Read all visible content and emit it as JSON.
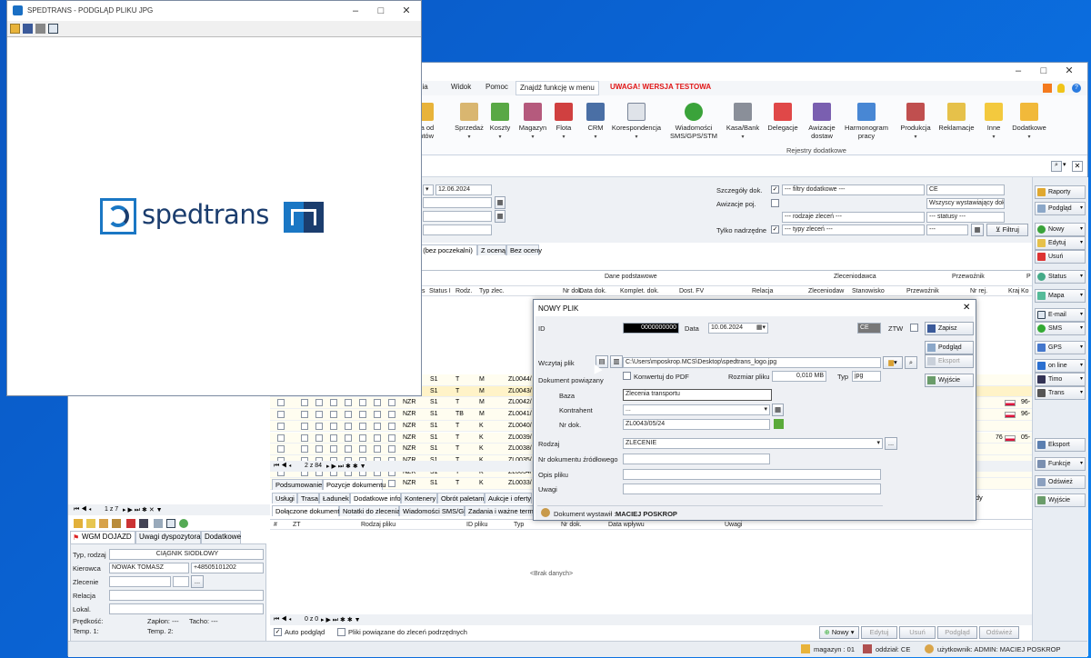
{
  "jpg_window": {
    "title": "SPEDTRANS - PODGLĄD PLIKU JPG",
    "logo_text": "spedtrans",
    "logo_colors": {
      "blue": "#1a77c4",
      "dark": "#1b3d6e"
    }
  },
  "main": {
    "menu": [
      "dzia",
      "Widok",
      "Pomoc",
      "Znajdź funkcję w menu"
    ],
    "warning": "UWAGA! WERSJA TESTOWA",
    "ribbon": [
      {
        "label": "nia od\nentów",
        "icon": "user-icon"
      },
      {
        "label": "Sprzedaż",
        "icon": "sales-icon"
      },
      {
        "label": "Koszty",
        "icon": "costs-icon"
      },
      {
        "label": "Magazyn",
        "icon": "warehouse-icon"
      },
      {
        "label": "Flota",
        "icon": "fleet-icon"
      },
      {
        "label": "CRM",
        "icon": "crm-icon"
      },
      {
        "label": "Korespondencja",
        "icon": "mail-icon"
      },
      {
        "label": "Wiadomości\nSMS/GPS/STM",
        "icon": "sms-icon"
      },
      {
        "label": "Kasa/Bank",
        "icon": "cash-icon"
      },
      {
        "label": "Delegacje",
        "icon": "calendar-icon"
      },
      {
        "label": "Awizacje\ndostaw",
        "icon": "notice-icon"
      },
      {
        "label": "Harmonogram\npracy",
        "icon": "schedule-icon"
      },
      {
        "label": "Produkcja",
        "icon": "production-icon"
      },
      {
        "label": "Reklamacje",
        "icon": "complaint-icon"
      },
      {
        "label": "Inne",
        "icon": "folder-icon"
      },
      {
        "label": "Dodatkowe",
        "icon": "folder-open-icon"
      }
    ],
    "ribbon_group": "Rejestry dodatkowe",
    "filters": {
      "date_to": "12.06.2024",
      "details_label": "Szczegóły dok.",
      "details_value": "--- filtry dodatkowe ---",
      "awizacje_label": "Awizacje poj.",
      "kinds_value": "--- rodzaje zleceń ---",
      "parent_label": "Tylko nadrzędne",
      "types_value": "--- typy zleceń ---",
      "ce_value": "CE",
      "issuers_value": "Wszyscy wystawiający dok.",
      "statuses_value": "--- statusy ---",
      "dash_value": "---",
      "filter_btn": "Filtruj"
    },
    "grade_tabs": [
      "e (bez poczekalni)",
      "Z oceną",
      "Bez oceny"
    ],
    "grid": {
      "group_main": "Dane podstawowe",
      "group_client": "Zleceniodawca",
      "group_carrier": "Przewoźnik",
      "group_p": "P",
      "headers": [
        "s",
        "Status I",
        "Rodz.",
        "Typ zlec.",
        "Nr dok.",
        "Data dok.",
        "Komplet. dok.",
        "Dost. FV",
        "Relacja",
        "Zleceniodaw",
        "Stanowisko",
        "Przewoźnik",
        "Nr rej.",
        "Kraj",
        "Ko"
      ],
      "rows": [
        {
          "status": "S1",
          "rodz": "T",
          "typ": "M",
          "nr": "ZL0044/",
          "k": "",
          "ko": ""
        },
        {
          "status": "S1",
          "rodz": "T",
          "typ": "M",
          "nr": "ZL0043/",
          "k": "",
          "ko": ""
        },
        {
          "status": "S1",
          "rodz": "T",
          "typ": "M",
          "nr": "ZL0042/",
          "k": "",
          "ko": "96-"
        },
        {
          "status": "S1",
          "rodz": "TB",
          "typ": "M",
          "nr": "ZL0041/",
          "k": "",
          "ko": "96-"
        },
        {
          "status": "S1",
          "rodz": "T",
          "typ": "K",
          "nr": "ZL0040/",
          "k": "",
          "ko": ""
        },
        {
          "status": "S1",
          "rodz": "T",
          "typ": "K",
          "nr": "ZL0039/",
          "k": "76",
          "ko": "05-"
        },
        {
          "status": "S1",
          "rodz": "T",
          "typ": "K",
          "nr": "ZL0038/",
          "k": "",
          "ko": ""
        },
        {
          "status": "S1",
          "rodz": "T",
          "typ": "K",
          "nr": "ZL0035/",
          "k": "",
          "ko": ""
        },
        {
          "status": "S1",
          "rodz": "T",
          "typ": "K",
          "nr": "ZL0034/",
          "k": "",
          "ko": ""
        },
        {
          "status": "S1",
          "rodz": "T",
          "typ": "K",
          "nr": "ZL0033/",
          "k": "",
          "ko": ""
        }
      ],
      "row_prefix": "NZR",
      "count": "84",
      "pager": "2 z 84"
    },
    "bottom_tabs1": [
      "Podsumowanie",
      "Pozycje dokumentu"
    ],
    "bottom_tabs2": [
      "Usługi",
      "Trasa",
      "Ładunek",
      "Dodatkowe info.",
      "Kontenery",
      "Obrót paletami",
      "Aukcje i oferty z"
    ],
    "bottom_tabs3": [
      "Dołączone dokumenty",
      "Notatki do zlecenia",
      "Wiadomości SMS/GPS",
      "Zadania i ważne termin"
    ],
    "bottom_extra_tab": "Ikdy",
    "docs_headers": [
      "ZT",
      "Rodzaj pliku",
      "ID pliku",
      "Typ",
      "Nr dok.",
      "Data wpływu",
      "Uwagi"
    ],
    "no_data": "<Brak danych>",
    "docs_pager": "0 z 0",
    "auto_preview": "Auto podgląd",
    "linked_files": "Pliki powiązane do zleceń podrzędnych",
    "bottom_buttons": [
      "Nowy",
      "Edytuj",
      "Usuń",
      "Podgląd",
      "Odśwież"
    ],
    "right_buttons": [
      "Raporty",
      "Podgląd",
      "Nowy",
      "Edytuj",
      "Usuń",
      "Status",
      "Mapa",
      "E-mail",
      "SMS",
      "GPS",
      "on line",
      "Timo",
      "Trans",
      "Eksport",
      "Funkcje",
      "Odśwież",
      "Wyjście"
    ],
    "left_panel": {
      "pager": "1 z 7",
      "tabs": [
        "WGM DOJAZD",
        "Uwagi dyspozytora",
        "Dodatkowe"
      ],
      "type_label": "Typ, rodzaj",
      "type_value": "CIĄGNIK SIODŁOWY",
      "driver_label": "Kierowca",
      "driver_value": "NOWAK TOMASZ",
      "phone": "+48505101202",
      "order_label": "Zlecenie",
      "relation_label": "Relacja",
      "location_label": "Lokal.",
      "speed_label": "Prędkość:",
      "ignition_label": "Zapłon: ---",
      "tacho_label": "Tacho: ---",
      "temp1_label": "Temp. 1:",
      "temp2_label": "Temp. 2:"
    },
    "status": {
      "warehouse": "magazyn : 01",
      "branch": "oddział: CE",
      "user": "użytkownik: ADMIN: MACIEJ POSKROP"
    }
  },
  "dialog": {
    "title": "NOWY PLIK",
    "id_label": "ID",
    "id_value": "0000000000",
    "date_label": "Data",
    "date_value": "10.06.2024",
    "ce_value": "CE",
    "ztw_label": "ZTW",
    "load_label": "Wczytaj plik",
    "path": "C:\\Users\\mposkrop.MCS\\Desktop\\spedtrans_logo.jpg",
    "convert_label": "Konwertuj do PDF",
    "size_label": "Rozmiar pliku",
    "size_value": "0,010 MB",
    "type_label": "Typ",
    "type_value": "jpg",
    "linked_label": "Dokument powiązany",
    "base_label": "Baza",
    "base_value": "Zlecenia transportu",
    "contractor_label": "Kontrahent",
    "contractor_value": "...",
    "docno_label": "Nr dok.",
    "docno_value": "ZL0043/05/24",
    "kind_label": "Rodzaj",
    "kind_value": "ZLECENIE",
    "source_label": "Nr dokumentu źródłowego",
    "desc_label": "Opis pliku",
    "notes_label": "Uwagi",
    "issued_label": "Dokument wystawił :",
    "issued_value": "MACIEJ POSKROP",
    "buttons": [
      "Zapisz",
      "Podgląd",
      "Eksport",
      "Wyjście"
    ]
  }
}
